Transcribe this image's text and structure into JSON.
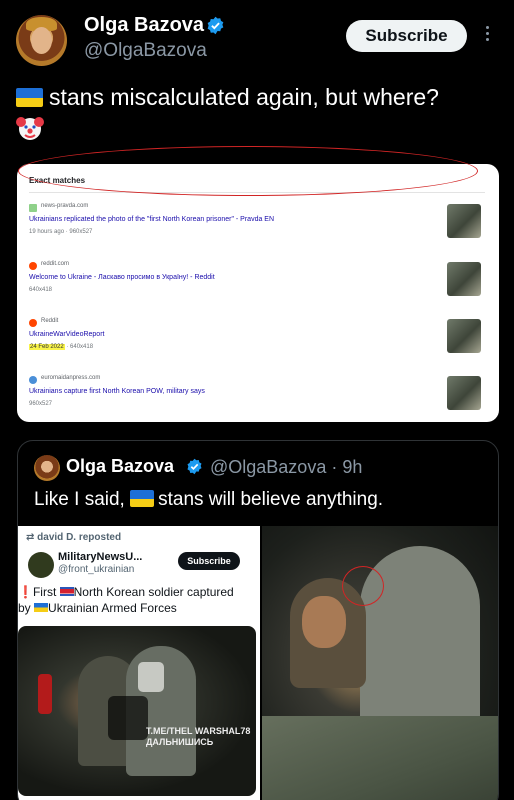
{
  "post": {
    "author_name": "Olga Bazova",
    "author_handle": "@OlgaBazova",
    "subscribe_label": "Subscribe",
    "text": "stans miscalculated again, but where?"
  },
  "search_card": {
    "heading": "Exact matches",
    "results": [
      {
        "source": "news-pravda.com",
        "title": "Ukrainians replicated the photo of the \"first North Korean prisoner\" - Pravda EN",
        "meta": "19 hours ago · 960x527",
        "date": "",
        "fav_color": "#8fd18a"
      },
      {
        "source": "reddit.com",
        "title": "Welcome to Ukraine - Ласкаво просимо в Україну! - Reddit",
        "meta": "640x418",
        "date": "",
        "fav_color": "#ff4500"
      },
      {
        "source": "Reddit",
        "title": "UkraineWarVideoReport",
        "meta": "· 640x418",
        "date": "24 Feb 2022",
        "fav_color": "#ff4500"
      },
      {
        "source": "euromaidanpress.com",
        "title": "Ukrainians capture first North Korean POW, military says",
        "meta": "960x527",
        "date": "",
        "fav_color": "#4a8fd8"
      }
    ]
  },
  "quote": {
    "author_name": "Olga Bazova",
    "author_handle": "@OlgaBazova · 9h",
    "text_before": "Like I said,",
    "text_after": "stans will believe anything.",
    "embedded": {
      "repost_line": "david D. reposted",
      "name": "MilitaryNewsU...",
      "handle": "@front_ukrainian",
      "subscribe_label": "Subscribe",
      "text_1": "First",
      "text_2": "North Korean soldier captured",
      "text_3": "by",
      "text_4": "Ukrainian Armed Forces",
      "watermark": "T.ME/THEL WARSHAL78 ДАЛЬНИШИСЬ"
    }
  },
  "icons": {
    "verified": "verified-badge-icon",
    "more": "more-options-icon",
    "clown": "clown-face-icon",
    "flag_ukraine": "ukraine-flag-icon"
  },
  "colors": {
    "background": "#000000",
    "verified_blue": "#1d9bf0",
    "highlight_red": "#d12525",
    "date_highlight": "#f8f34a"
  }
}
